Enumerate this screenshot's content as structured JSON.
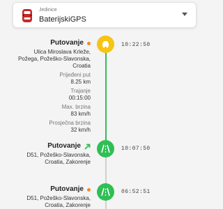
{
  "unit": {
    "caption": "Jedinice",
    "value": "BaterijskiGPS"
  },
  "colors": {
    "accent_orange": "#f28c28",
    "node_yellow": "#f6c413",
    "node_green": "#2fbf55",
    "line_green": "#2fbf55"
  },
  "entries": [
    {
      "title": "Putovanje",
      "indicator": "orange-dot",
      "address_line1": "Ulica Miroslava Krleže,",
      "address_line2": "Požega, Požeško-Slavonska,",
      "address_line3": "Croatia",
      "time": "10:22:50",
      "node_icon": "parking-icon",
      "stats": [
        {
          "label": "Prijeđeni put",
          "value": "8.25 km"
        },
        {
          "label": "Trajanje",
          "value": "00:15:00"
        },
        {
          "label": "Max. brzina",
          "value": "83 km/h"
        },
        {
          "label": "Prosječna brzina",
          "value": "32 km/h"
        }
      ]
    },
    {
      "title": "Putovanje",
      "indicator": "green-arrow-icon",
      "address_line1": "D51, Požeško-Slavonska,",
      "address_line2": "Croatia, Zakorenje",
      "time": "10:07:50",
      "node_icon": "road-icon"
    },
    {
      "title": "Putovanje",
      "indicator": "orange-dot",
      "address_line1": "D51, Požeško-Slavonska,",
      "address_line2": "Croatia, Zakorenje",
      "time": "06:52:51",
      "node_icon": "road-icon"
    }
  ]
}
